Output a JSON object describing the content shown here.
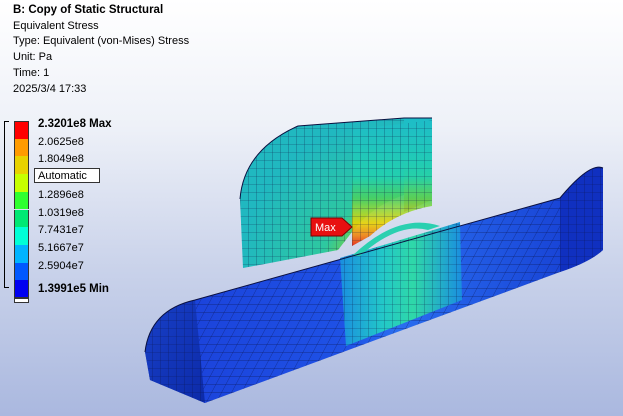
{
  "header": {
    "title": "B: Copy of Static Structural",
    "result_name": "Equivalent Stress",
    "type_line": "Type: Equivalent (von-Mises) Stress",
    "unit_line": "Unit: Pa",
    "time_line": "Time: 1",
    "date_line": "2025/3/4 17:33"
  },
  "legend": {
    "mode_label": "Automatic",
    "labels": [
      "2.3201e8 Max",
      "2.0625e8",
      "1.8049e8",
      "",
      "1.2896e8",
      "1.0319e8",
      "7.7431e7",
      "5.1667e7",
      "2.5904e7",
      "1.3991e5 Min"
    ],
    "colors": [
      "#ff0000",
      "#ff9b00",
      "#e8d200",
      "#c6ff00",
      "#2fff30",
      "#00e874",
      "#00ffd6",
      "#00b4ff",
      "#0058ff",
      "#0000f0"
    ]
  },
  "probe": {
    "max_label": "Max"
  },
  "colors": {
    "probe_bg": "#e81010",
    "mesh_line": "#0a1040"
  }
}
